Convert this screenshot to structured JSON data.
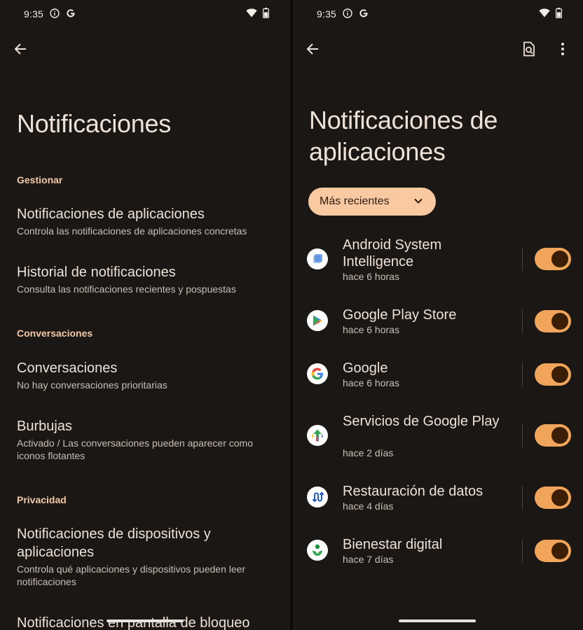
{
  "left": {
    "status": {
      "time": "9:35"
    },
    "title": "Notificaciones",
    "sections": {
      "manage": "Gestionar",
      "conversations": "Conversaciones",
      "privacy": "Privacidad"
    },
    "items": [
      {
        "title": "Notificaciones de aplicaciones",
        "subtitle": "Controla las notificaciones de aplicaciones concretas"
      },
      {
        "title": "Historial de notificaciones",
        "subtitle": "Consulta las notificaciones recientes y pospuestas"
      },
      {
        "title": "Conversaciones",
        "subtitle": "No hay conversaciones prioritarias"
      },
      {
        "title": "Burbujas",
        "subtitle": "Activado / Las conversaciones pueden aparecer como iconos flotantes"
      },
      {
        "title": "Notificaciones de dispositivos y aplicaciones",
        "subtitle": "Controla qué aplicaciones y dispositivos pueden leer notificaciones"
      },
      {
        "title": "Notificaciones en pantalla de bloqueo"
      }
    ]
  },
  "right": {
    "status": {
      "time": "9:35"
    },
    "title": "Notificaciones de aplicaciones",
    "filter": {
      "label": "Más recientes"
    },
    "apps": [
      {
        "name": "Android System Intelligence",
        "time": "hace 6 horas",
        "icon": "android-system-intelligence-icon",
        "enabled": true
      },
      {
        "name": "Google Play Store",
        "time": "hace 6 horas",
        "icon": "play-store-icon",
        "enabled": true
      },
      {
        "name": "Google",
        "time": "hace 6 horas",
        "icon": "google-icon",
        "enabled": true
      },
      {
        "name": "Servicios de Google Play",
        "time": "hace 2 días",
        "icon": "play-services-icon",
        "enabled": true
      },
      {
        "name": "Restauración de datos",
        "time": "hace 4 días",
        "icon": "data-restore-icon",
        "enabled": true
      },
      {
        "name": "Bienestar digital",
        "time": "hace 7 días",
        "icon": "digital-wellbeing-icon",
        "enabled": true
      }
    ]
  },
  "colors": {
    "background": "#1b1714",
    "accent_section": "#f3c9a8",
    "chip": "#f9c9a1",
    "toggle_track": "#f0a55b",
    "toggle_knob": "#3a1e05"
  }
}
